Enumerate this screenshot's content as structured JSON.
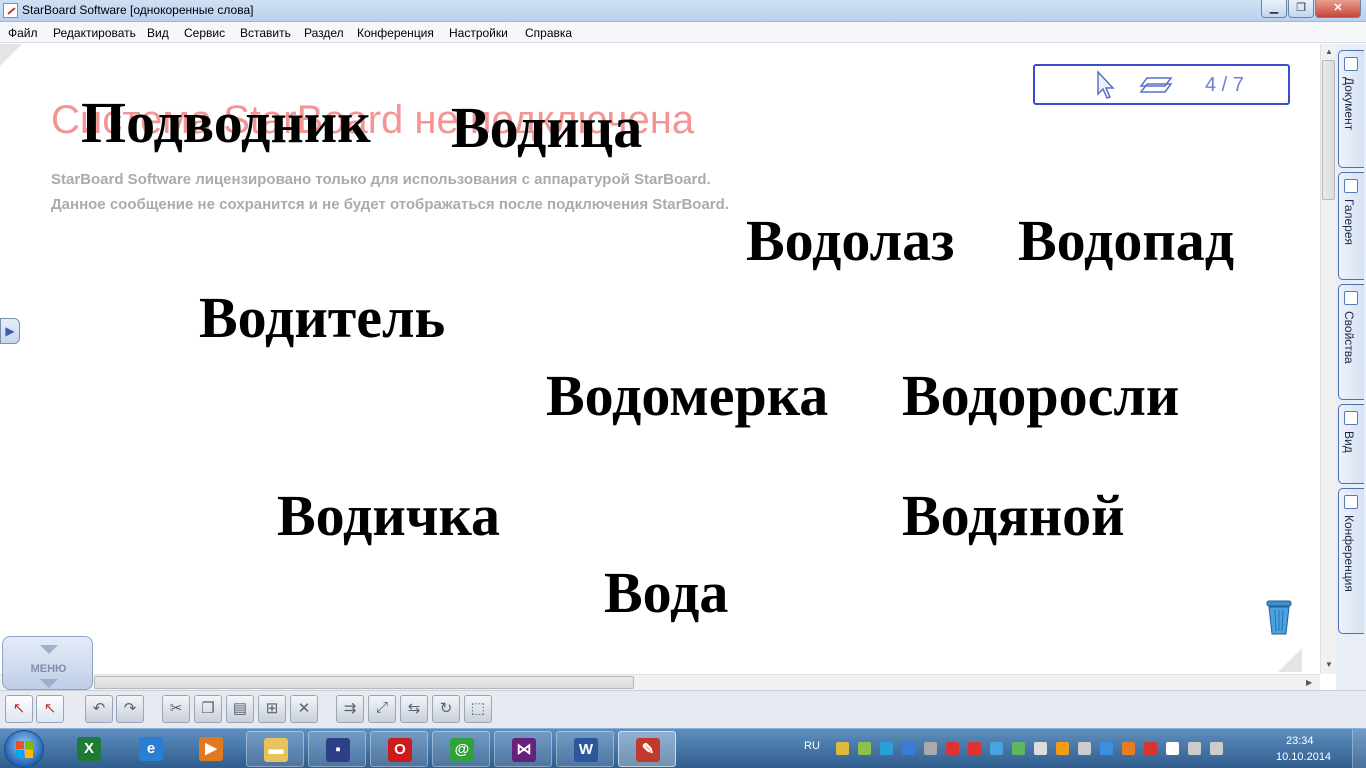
{
  "window": {
    "title": "StarBoard Software [однокоренные слова]"
  },
  "menubar": {
    "items": [
      "Файл",
      "Редактировать",
      "Вид",
      "Сервис",
      "Вставить",
      "Раздел",
      "Конференция",
      "Настройки",
      "Справка"
    ]
  },
  "canvas": {
    "watermark": "Система StarBoard не подключена",
    "license_lines": [
      "StarBoard Software лицензировано только для использования с аппаратурой StarBoard.",
      "Данное сообщение не сохранится и не будет отображаться после подключения StarBoard."
    ],
    "words": [
      "Подводник",
      "Водица",
      "Водолаз",
      "Водопад",
      "Водитель",
      "Водомерка",
      "Водоросли",
      "Водичка",
      "Водяной",
      "Вода"
    ]
  },
  "page_nav": {
    "counter": "4 / 7"
  },
  "right_tabs": [
    "Документ",
    "Галерея",
    "Свойства",
    "Вид",
    "Конференция"
  ],
  "menu_button": {
    "label": "МЕНЮ"
  },
  "toolbar": {
    "buttons": [
      {
        "name": "add-page",
        "icon": "cursor-plus-icon"
      },
      {
        "name": "page-select",
        "icon": "cursor-number-icon"
      },
      {
        "name": "undo",
        "icon": "undo-icon"
      },
      {
        "name": "redo",
        "icon": "redo-icon"
      },
      {
        "name": "cut",
        "icon": "cut-icon"
      },
      {
        "name": "copy",
        "icon": "copy-icon"
      },
      {
        "name": "paste",
        "icon": "paste-icon"
      },
      {
        "name": "duplicate",
        "icon": "duplicate-icon"
      },
      {
        "name": "delete",
        "icon": "delete-icon"
      },
      {
        "name": "group",
        "icon": "group-icon"
      },
      {
        "name": "resize",
        "icon": "resize-icon"
      },
      {
        "name": "flip",
        "icon": "flip-icon"
      },
      {
        "name": "rotate",
        "icon": "rotate-icon"
      },
      {
        "name": "select-area",
        "icon": "select-area-icon"
      }
    ]
  },
  "taskbar": {
    "items": [
      {
        "name": "excel",
        "icon": "excel-icon",
        "glyph": "X",
        "color": "#1e7b34"
      },
      {
        "name": "internet-explorer",
        "icon": "ie-icon",
        "glyph": "e",
        "color": "#2a7ed3"
      },
      {
        "name": "media-player",
        "icon": "media-player-icon",
        "glyph": "▶",
        "color": "#e07a1f"
      },
      {
        "name": "explorer",
        "icon": "folder-icon",
        "glyph": "▬",
        "color": "#e8c25a"
      },
      {
        "name": "save-app",
        "icon": "floppy-icon",
        "glyph": "▪",
        "color": "#2d3f86"
      },
      {
        "name": "opera",
        "icon": "opera-icon",
        "glyph": "O",
        "color": "#cc1b1b"
      },
      {
        "name": "mail-agent",
        "icon": "at-icon",
        "glyph": "@",
        "color": "#2fa23b"
      },
      {
        "name": "visual-studio",
        "icon": "visual-studio-icon",
        "glyph": "⋈",
        "color": "#68217a"
      },
      {
        "name": "word",
        "icon": "word-icon",
        "glyph": "W",
        "color": "#2b579a"
      },
      {
        "name": "starboard",
        "icon": "starboard-icon",
        "glyph": "✎",
        "color": "#c0392b"
      }
    ],
    "language": "RU",
    "tray_colors": [
      "#e0b93a",
      "#8bc34a",
      "#2b9fd9",
      "#3a7bd5",
      "#aaaaaa",
      "#d33",
      "#d33",
      "#4aa3df",
      "#5fb85f",
      "#dddddd",
      "#f39c12",
      "#cccccc",
      "#3d8ee0",
      "#e67e22",
      "#d9342b",
      "#ffffff",
      "#cccccc",
      "#cccccc"
    ],
    "clock": {
      "time": "23:34",
      "date": "10.10.2014"
    }
  }
}
